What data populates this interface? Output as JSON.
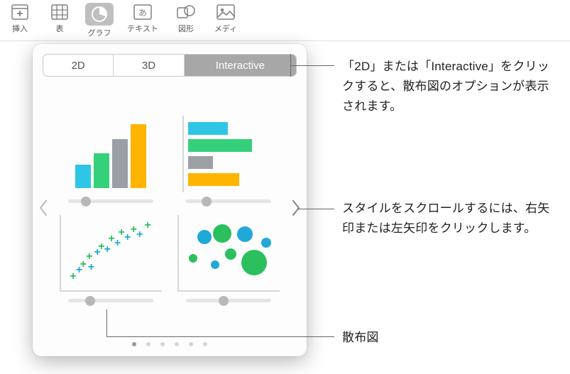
{
  "toolbar": {
    "items": [
      {
        "id": "insert",
        "label": "挿入"
      },
      {
        "id": "table",
        "label": "表"
      },
      {
        "id": "graph",
        "label": "グラフ"
      },
      {
        "id": "text",
        "label": "テキスト"
      },
      {
        "id": "shape",
        "label": "図形"
      },
      {
        "id": "media",
        "label": "メディ"
      }
    ]
  },
  "segmented": {
    "items": [
      {
        "id": "2d",
        "label": "2D"
      },
      {
        "id": "3d",
        "label": "3D"
      },
      {
        "id": "interactive",
        "label": "Interactive"
      }
    ],
    "selected": "interactive"
  },
  "dots": {
    "count": 6,
    "active": 0
  },
  "callouts": {
    "a": "「2D」または「Interactive」をクリックすると、散布図のオプションが表示されます。",
    "b": "スタイルをスクロールするには、右矢印または左矢印をクリックします。",
    "c": "散布図"
  },
  "colors": {
    "bar1": "#2fc6e6",
    "bar2": "#35d07a",
    "bar3": "#9aa0a5",
    "bar4": "#ffb400",
    "green": "#2bbf5d",
    "blue": "#1fa8d8"
  }
}
